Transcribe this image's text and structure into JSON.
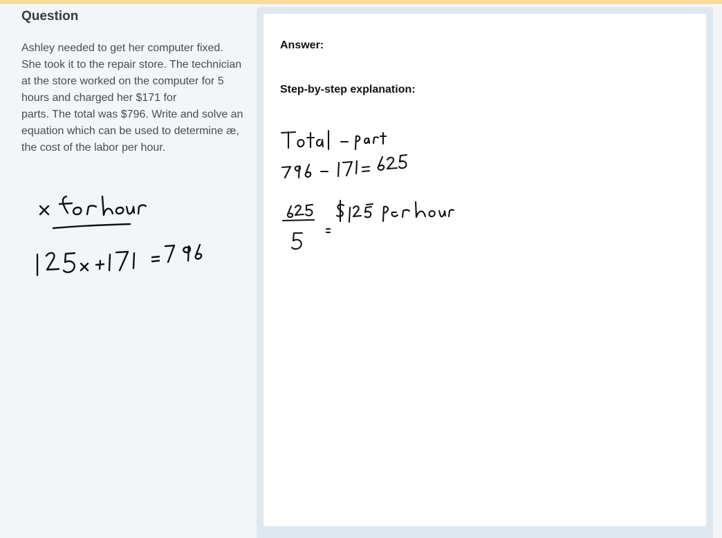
{
  "question": {
    "heading": "Question",
    "lines": [
      "Ashley needed to get her computer fixed. She took it to the repair store. The technician at the store worked on the computer for 5 hours and charged her $171 for",
      "parts. The total was $796. Write and solve an equation which can be used to determine æ, the cost of the labor per hour."
    ],
    "handwritten_note": "x for hour",
    "handwritten_equation": "125x + 171 = 796"
  },
  "answer": {
    "answer_label": "Answer:",
    "steps_label": "Step-by-step explanation:",
    "handwritten_step_1": "Total - part",
    "handwritten_step_2": "796 - 171 = 625",
    "handwritten_step_3": "625/5 = $125 per hour"
  },
  "colors": {
    "top_bar": "#f8dc9a",
    "page_background": "#f3f6f9",
    "answer_frame": "#dfe7f0",
    "answer_card": "#ffffff",
    "ink": "#111111"
  }
}
